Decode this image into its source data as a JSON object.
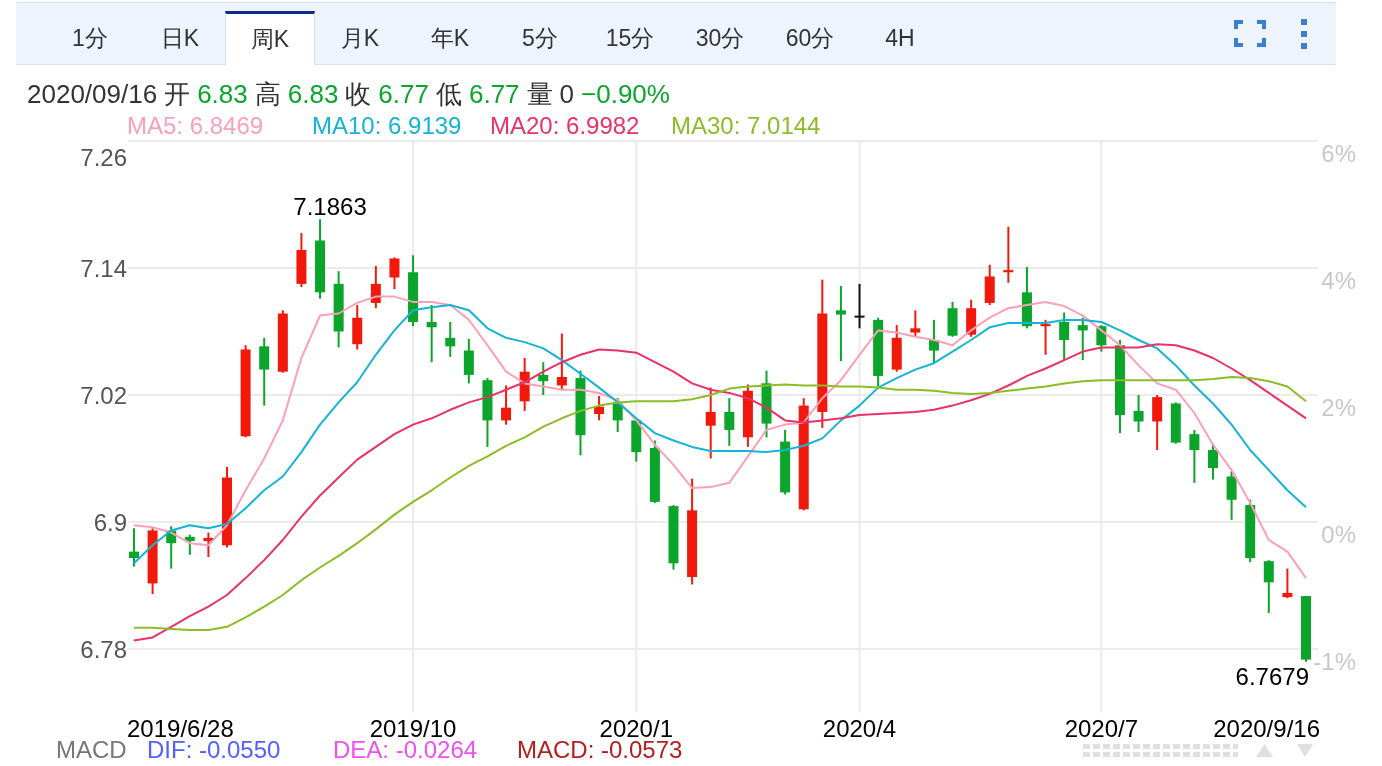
{
  "tabs": [
    {
      "label": "1分",
      "selected": false
    },
    {
      "label": "日K",
      "selected": false
    },
    {
      "label": "周K",
      "selected": true
    },
    {
      "label": "月K",
      "selected": false
    },
    {
      "label": "年K",
      "selected": false
    },
    {
      "label": "5分",
      "selected": false
    },
    {
      "label": "15分",
      "selected": false
    },
    {
      "label": "30分",
      "selected": false
    },
    {
      "label": "60分",
      "selected": false
    },
    {
      "label": "4H",
      "selected": false
    }
  ],
  "quote": {
    "date": "2020/09/16",
    "fields": [
      {
        "label": "开",
        "value": "6.83",
        "color": "#0aa52a"
      },
      {
        "label": "高",
        "value": "6.83",
        "color": "#0aa52a"
      },
      {
        "label": "收",
        "value": "6.77",
        "color": "#0aa52a"
      },
      {
        "label": "低",
        "value": "6.77",
        "color": "#0aa52a"
      },
      {
        "label": "量",
        "value": "0",
        "color": "#333333"
      }
    ],
    "change": {
      "text": "−0.90%",
      "color": "#0aa52a"
    }
  },
  "chart": {
    "range_start": "2019/6/28",
    "range_end": "2020/9/16",
    "right_axis_labels": [
      "6%",
      "4%",
      "2%",
      "0%",
      "-1%"
    ],
    "chart_data": {
      "type": "candlestick",
      "grid": true,
      "categories": [
        null,
        null,
        null,
        null,
        null,
        null,
        null,
        null,
        null,
        null,
        null,
        null,
        null,
        null,
        null,
        "2019/10",
        null,
        null,
        null,
        null,
        null,
        null,
        null,
        null,
        null,
        null,
        null,
        "2020/1",
        null,
        null,
        null,
        null,
        null,
        null,
        null,
        null,
        null,
        null,
        null,
        "2020/4",
        null,
        null,
        null,
        null,
        null,
        null,
        null,
        null,
        null,
        null,
        null,
        null,
        "2020/7",
        null,
        null,
        null,
        null,
        null,
        null,
        null,
        null,
        null,
        null,
        null
      ],
      "yticks": [
        6.78,
        6.9,
        7.02,
        7.14,
        7.26
      ],
      "ylim": [
        6.72,
        7.26
      ],
      "ohlc": [
        [
          6.872,
          6.894,
          6.858,
          6.866
        ],
        [
          6.842,
          6.894,
          6.832,
          6.892
        ],
        [
          6.892,
          6.896,
          6.856,
          6.88
        ],
        [
          6.886,
          6.888,
          6.869,
          6.882
        ],
        [
          6.882,
          6.89,
          6.867,
          6.885
        ],
        [
          6.878,
          6.952,
          6.876,
          6.942
        ],
        [
          6.981,
          7.067,
          6.98,
          7.063
        ],
        [
          7.066,
          7.074,
          7.01,
          7.044
        ],
        [
          7.042,
          7.1,
          7.041,
          7.097
        ],
        [
          7.125,
          7.173,
          7.122,
          7.157
        ],
        [
          7.166,
          7.186,
          7.111,
          7.117
        ],
        [
          7.125,
          7.137,
          7.065,
          7.08
        ],
        [
          7.068,
          7.105,
          7.063,
          7.093
        ],
        [
          7.107,
          7.142,
          7.102,
          7.125
        ],
        [
          7.131,
          7.15,
          7.12,
          7.149
        ],
        [
          7.136,
          7.152,
          7.085,
          7.089
        ],
        [
          7.089,
          7.105,
          7.051,
          7.084
        ],
        [
          7.074,
          7.089,
          7.056,
          7.066
        ],
        [
          7.062,
          7.073,
          7.031,
          7.039
        ],
        [
          7.034,
          7.036,
          6.971,
          6.996
        ],
        [
          6.996,
          7.029,
          6.992,
          7.008
        ],
        [
          7.014,
          7.055,
          7.005,
          7.042
        ],
        [
          7.039,
          7.051,
          7.02,
          7.033
        ],
        [
          7.029,
          7.078,
          7.025,
          7.037
        ],
        [
          7.036,
          7.043,
          6.963,
          6.982
        ],
        [
          7.002,
          7.019,
          6.996,
          7.009
        ],
        [
          7.012,
          7.017,
          6.985,
          6.996
        ],
        [
          6.996,
          6.998,
          6.957,
          6.966
        ],
        [
          6.97,
          6.977,
          6.918,
          6.919
        ],
        [
          6.915,
          6.916,
          6.855,
          6.861
        ],
        [
          6.848,
          6.941,
          6.841,
          6.911
        ],
        [
          6.991,
          7.027,
          6.96,
          7.004
        ],
        [
          7.004,
          7.017,
          6.972,
          6.987
        ],
        [
          6.98,
          7.03,
          6.971,
          7.024
        ],
        [
          7.031,
          7.043,
          6.98,
          6.993
        ],
        [
          6.976,
          6.987,
          6.926,
          6.928
        ],
        [
          6.912,
          7.017,
          6.911,
          7.01
        ],
        [
          7.004,
          7.129,
          6.989,
          7.097
        ],
        [
          7.1,
          7.123,
          7.052,
          7.096
        ],
        [
          7.095,
          7.125,
          7.083,
          7.095
        ],
        [
          7.091,
          7.093,
          7.028,
          7.038
        ],
        [
          7.044,
          7.086,
          7.042,
          7.074
        ],
        [
          7.079,
          7.1,
          7.075,
          7.083
        ],
        [
          7.072,
          7.091,
          7.05,
          7.062
        ],
        [
          7.102,
          7.108,
          7.075,
          7.076
        ],
        [
          7.077,
          7.11,
          7.075,
          7.102
        ],
        [
          7.107,
          7.143,
          7.105,
          7.132
        ],
        [
          7.136,
          7.179,
          7.126,
          7.138
        ],
        [
          7.117,
          7.141,
          7.083,
          7.085
        ],
        [
          7.085,
          7.091,
          7.058,
          7.087
        ],
        [
          7.089,
          7.098,
          7.053,
          7.072
        ],
        [
          7.086,
          7.093,
          7.053,
          7.081
        ],
        [
          7.085,
          7.086,
          7.061,
          7.067
        ],
        [
          7.067,
          7.072,
          6.984,
          7.001
        ],
        [
          7.005,
          7.02,
          6.985,
          6.995
        ],
        [
          6.995,
          7.02,
          6.968,
          7.018
        ],
        [
          7.012,
          7.013,
          6.974,
          6.975
        ],
        [
          6.983,
          6.987,
          6.937,
          6.968
        ],
        [
          6.968,
          6.974,
          6.94,
          6.951
        ],
        [
          6.943,
          6.948,
          6.902,
          6.921
        ],
        [
          6.916,
          6.921,
          6.862,
          6.866
        ],
        [
          6.863,
          6.864,
          6.814,
          6.843
        ],
        [
          6.829,
          6.856,
          6.828,
          6.833
        ],
        [
          6.83,
          6.83,
          6.768,
          6.77
        ]
      ],
      "series": [
        {
          "name": "MA5: 6.8469",
          "type": "line",
          "color": "#fca0b9",
          "values": [
            6.897,
            6.895,
            6.89,
            6.88,
            6.878,
            6.897,
            6.93,
            6.96,
            6.996,
            7.055,
            7.095,
            7.097,
            7.107,
            7.113,
            7.113,
            7.108,
            7.108,
            7.105,
            7.091,
            7.067,
            7.042,
            7.031,
            7.028,
            7.025,
            7.025,
            7.022,
            7.015,
            6.996,
            6.973,
            6.954,
            6.932,
            6.933,
            6.937,
            6.962,
            6.987,
            6.992,
            6.994,
            7.017,
            7.034,
            7.058,
            7.081,
            7.079,
            7.075,
            7.072,
            7.067,
            7.081,
            7.093,
            7.102,
            7.105,
            7.108,
            7.104,
            7.095,
            7.081,
            7.067,
            7.048,
            7.031,
            7.025,
            7.003,
            6.973,
            6.949,
            6.918,
            6.883,
            6.872,
            6.847
          ]
        },
        {
          "name": "MA10: 6.9139",
          "type": "line",
          "color": "#14b4d7",
          "values": [
            6.861,
            6.878,
            6.892,
            6.897,
            6.894,
            6.898,
            6.913,
            6.93,
            6.943,
            6.966,
            6.992,
            7.013,
            7.032,
            7.058,
            7.081,
            7.1,
            7.103,
            7.105,
            7.1,
            7.083,
            7.074,
            7.07,
            7.064,
            7.053,
            7.04,
            7.027,
            7.013,
            6.998,
            6.984,
            6.977,
            6.971,
            6.967,
            6.967,
            6.967,
            6.966,
            6.968,
            6.972,
            6.979,
            6.996,
            7.01,
            7.027,
            7.036,
            7.044,
            7.05,
            7.061,
            7.072,
            7.084,
            7.088,
            7.088,
            7.088,
            7.091,
            7.091,
            7.089,
            7.081,
            7.072,
            7.064,
            7.048,
            7.029,
            7.012,
            6.992,
            6.968,
            6.949,
            6.93,
            6.914
          ]
        },
        {
          "name": "MA20: 6.9982",
          "type": "line",
          "color": "#e83269",
          "values": [
            6.788,
            6.791,
            6.801,
            6.811,
            6.82,
            6.831,
            6.847,
            6.864,
            6.883,
            6.905,
            6.925,
            6.942,
            6.959,
            6.971,
            6.983,
            6.992,
            6.998,
            7.006,
            7.013,
            7.018,
            7.025,
            7.032,
            7.042,
            7.051,
            7.058,
            7.063,
            7.062,
            7.06,
            7.051,
            7.042,
            7.031,
            7.025,
            7.022,
            7.017,
            7.008,
            6.996,
            6.994,
            6.996,
            6.998,
            7.001,
            7.002,
            7.003,
            7.004,
            7.006,
            7.01,
            7.015,
            7.021,
            7.029,
            7.038,
            7.045,
            7.053,
            7.061,
            7.065,
            7.065,
            7.065,
            7.068,
            7.067,
            7.062,
            7.055,
            7.045,
            7.034,
            7.022,
            7.01,
            6.998
          ]
        },
        {
          "name": "MA30: 7.0144",
          "type": "line",
          "color": "#8cbc28",
          "values": [
            6.8,
            6.8,
            6.799,
            6.798,
            6.798,
            6.801,
            6.81,
            6.82,
            6.831,
            6.845,
            6.857,
            6.868,
            6.88,
            6.893,
            6.907,
            6.919,
            6.93,
            6.942,
            6.953,
            6.962,
            6.972,
            6.98,
            6.99,
            6.998,
            7.005,
            7.01,
            7.013,
            7.014,
            7.014,
            7.014,
            7.016,
            7.02,
            7.026,
            7.028,
            7.029,
            7.03,
            7.029,
            7.029,
            7.028,
            7.028,
            7.027,
            7.025,
            7.025,
            7.024,
            7.022,
            7.021,
            7.022,
            7.024,
            7.026,
            7.028,
            7.031,
            7.033,
            7.034,
            7.034,
            7.034,
            7.034,
            7.034,
            7.034,
            7.035,
            7.037,
            7.036,
            7.033,
            7.028,
            7.014
          ]
        }
      ],
      "annotations": [
        "7.1863",
        "6.7679"
      ]
    }
  },
  "macd_legend": {
    "title": "MACD",
    "items": [
      {
        "text": "DIF: -0.0550",
        "color": "#5060ff"
      },
      {
        "text": "DEA: -0.0264",
        "color": "#f050f0"
      },
      {
        "text": "MACD: -0.0573",
        "color": "#b41e1e"
      }
    ]
  }
}
